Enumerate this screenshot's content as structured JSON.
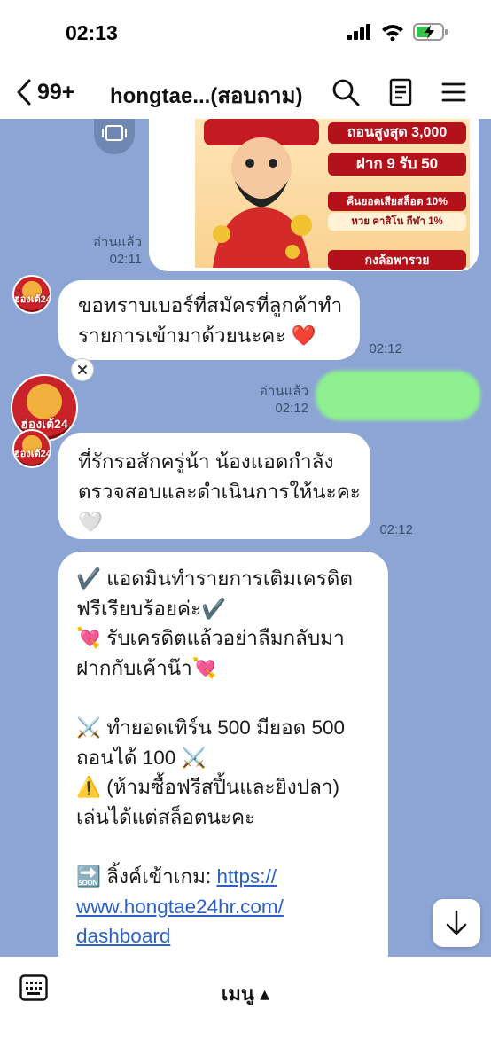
{
  "status_bar": {
    "time": "02:13"
  },
  "header": {
    "unread_count": "99+",
    "title": "hongtae...(สอบถาม)"
  },
  "promo_image": {
    "lines": [
      "ถอนสูงสุด 3,000",
      "ฝาก 9 รับ 50",
      "คืนยอดเสียสล็อต 10%",
      "หวย คาสิโน กีฬา 1%",
      "กงล้อพารวย"
    ],
    "read_label": "อ่านแล้ว",
    "time": "02:11"
  },
  "messages": [
    {
      "from": "admin",
      "text": "ขอทราบเบอร์ที่สมัครที่ลูกค้าทำรายการเข้ามาด้วยนะคะ ❤️",
      "line1": "ขอทราบเบอร์ที่สมัครที่ลูกค้าทำ",
      "line2": "รายการเข้ามาด้วยนะคะ ❤️",
      "time": "02:12"
    },
    {
      "from": "me",
      "read_label": "อ่านแล้ว",
      "time": "02:12"
    },
    {
      "from": "admin",
      "line1": "ที่รักรอสักครู่น้า น้องแอดกำลัง",
      "line2": "ตรวจสอบและดำเนินการให้นะคะ",
      "line3": "🤍",
      "time": "02:12"
    },
    {
      "from": "admin",
      "lines": [
        "✔️ แอดมินทำรายการเติมเครดิต",
        "ฟรีเรียบร้อยค่ะ✔️",
        "💘 รับเครดิตแล้วอย่าลืมกลับมา",
        "ฝากกับเค้าน๊า💘",
        "",
        "⚔️ ทำยอดเทิร์น 500 มียอด 500",
        "ถอนได้ 100 ⚔️",
        "⚠️ (ห้ามซื้อฟรีสปิ้นและยิงปลา)",
        "เล่นได้แต่สล็อตนะคะ",
        ""
      ],
      "link_prefix": "🔜 ลิ้งค์เข้าเกม: ",
      "link_1": "https://",
      "link_2": "www.hongtae24hr.com/",
      "link_3": "dashboard"
    }
  ],
  "avatar_label": "ฮ่องเต้24",
  "bottom_bar": {
    "menu_label": "เมนู ▴"
  },
  "colors": {
    "chat_bg": "#8ca5d5",
    "my_bubble": "#8ef08f",
    "link": "#2c62c6"
  }
}
